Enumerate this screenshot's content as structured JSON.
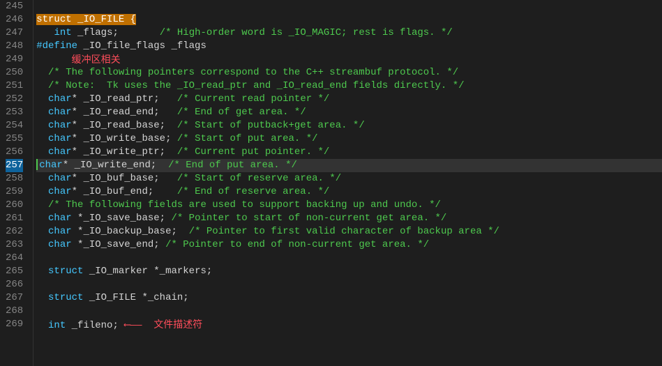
{
  "gutter": [
    "245",
    "246",
    "247",
    "248",
    "249",
    "250",
    "251",
    "252",
    "253",
    "254",
    "255",
    "256",
    "257",
    "258",
    "259",
    "260",
    "261",
    "262",
    "263",
    "264",
    "265",
    "266",
    "267",
    "268",
    "269"
  ],
  "current_line_index": 12,
  "annotations": {
    "buffer_related": "缓冲区相关",
    "file_descriptor": "文件描述符"
  },
  "code": {
    "l245": "",
    "l246_kw": "struct",
    "l246_name": " _IO_FILE {",
    "l247_indent": "   ",
    "l247_type": "int",
    "l247_ident": " _flags;",
    "l247_cmt": "/* High-order word is _IO_MAGIC; rest is flags. */",
    "l248_pp": "#define",
    "l248_rest": " _IO_file_flags _flags",
    "l249": "",
    "l250_cmt": "/* The following pointers correspond to the C++ streambuf protocol. */",
    "l251_cmt": "/* Note:  Tk uses the _IO_read_ptr and _IO_read_end fields directly. */",
    "l252_type": "char",
    "l252_ident": "* _IO_read_ptr;",
    "l252_cmt": "/* Current read pointer */",
    "l253_type": "char",
    "l253_ident": "* _IO_read_end;",
    "l253_cmt": "/* End of get area. */",
    "l254_type": "char",
    "l254_ident": "* _IO_read_base;",
    "l254_cmt": "/* Start of putback+get area. */",
    "l255_type": "char",
    "l255_ident": "* _IO_write_base;",
    "l255_cmt": "/* Start of put area. */",
    "l256_type": "char",
    "l256_ident": "* _IO_write_ptr;",
    "l256_cmt": "/* Current put pointer. */",
    "l257_type": "char",
    "l257_ident": "* _IO_write_end;",
    "l257_cmt": "/* End of put area. */",
    "l258_type": "char",
    "l258_ident": "* _IO_buf_base;",
    "l258_cmt": "/* Start of reserve area. */",
    "l259_type": "char",
    "l259_ident": "* _IO_buf_end;",
    "l259_cmt": "/* End of reserve area. */",
    "l260_cmt": "/* The following fields are used to support backing up and undo. */",
    "l261_type": "char",
    "l261_ident": " *_IO_save_base;",
    "l261_cmt": "/* Pointer to start of non-current get area. */",
    "l262_type": "char",
    "l262_ident": " *_IO_backup_base;",
    "l262_cmt": "/* Pointer to first valid character of backup area */",
    "l263_type": "char",
    "l263_ident": " *_IO_save_end;",
    "l263_cmt": "/* Pointer to end of non-current get area. */",
    "l264": "",
    "l265_kw": "struct",
    "l265_rest": " _IO_marker *_markers;",
    "l266": "",
    "l267_kw": "struct",
    "l267_rest": " _IO_FILE *_chain;",
    "l268": "",
    "l269_type": "int",
    "l269_ident": " _fileno;",
    "indent2": "  ",
    "pad_247": "       ",
    "pad_252": "   ",
    "pad_253": "   ",
    "pad_254": "  ",
    "pad_255": " ",
    "pad_256": "  ",
    "pad_257": "  ",
    "pad_258": "   ",
    "pad_259": "    ",
    "pad_261": " ",
    "pad_262": "  ",
    "pad_263": " "
  },
  "arrow": " ⟵——  "
}
